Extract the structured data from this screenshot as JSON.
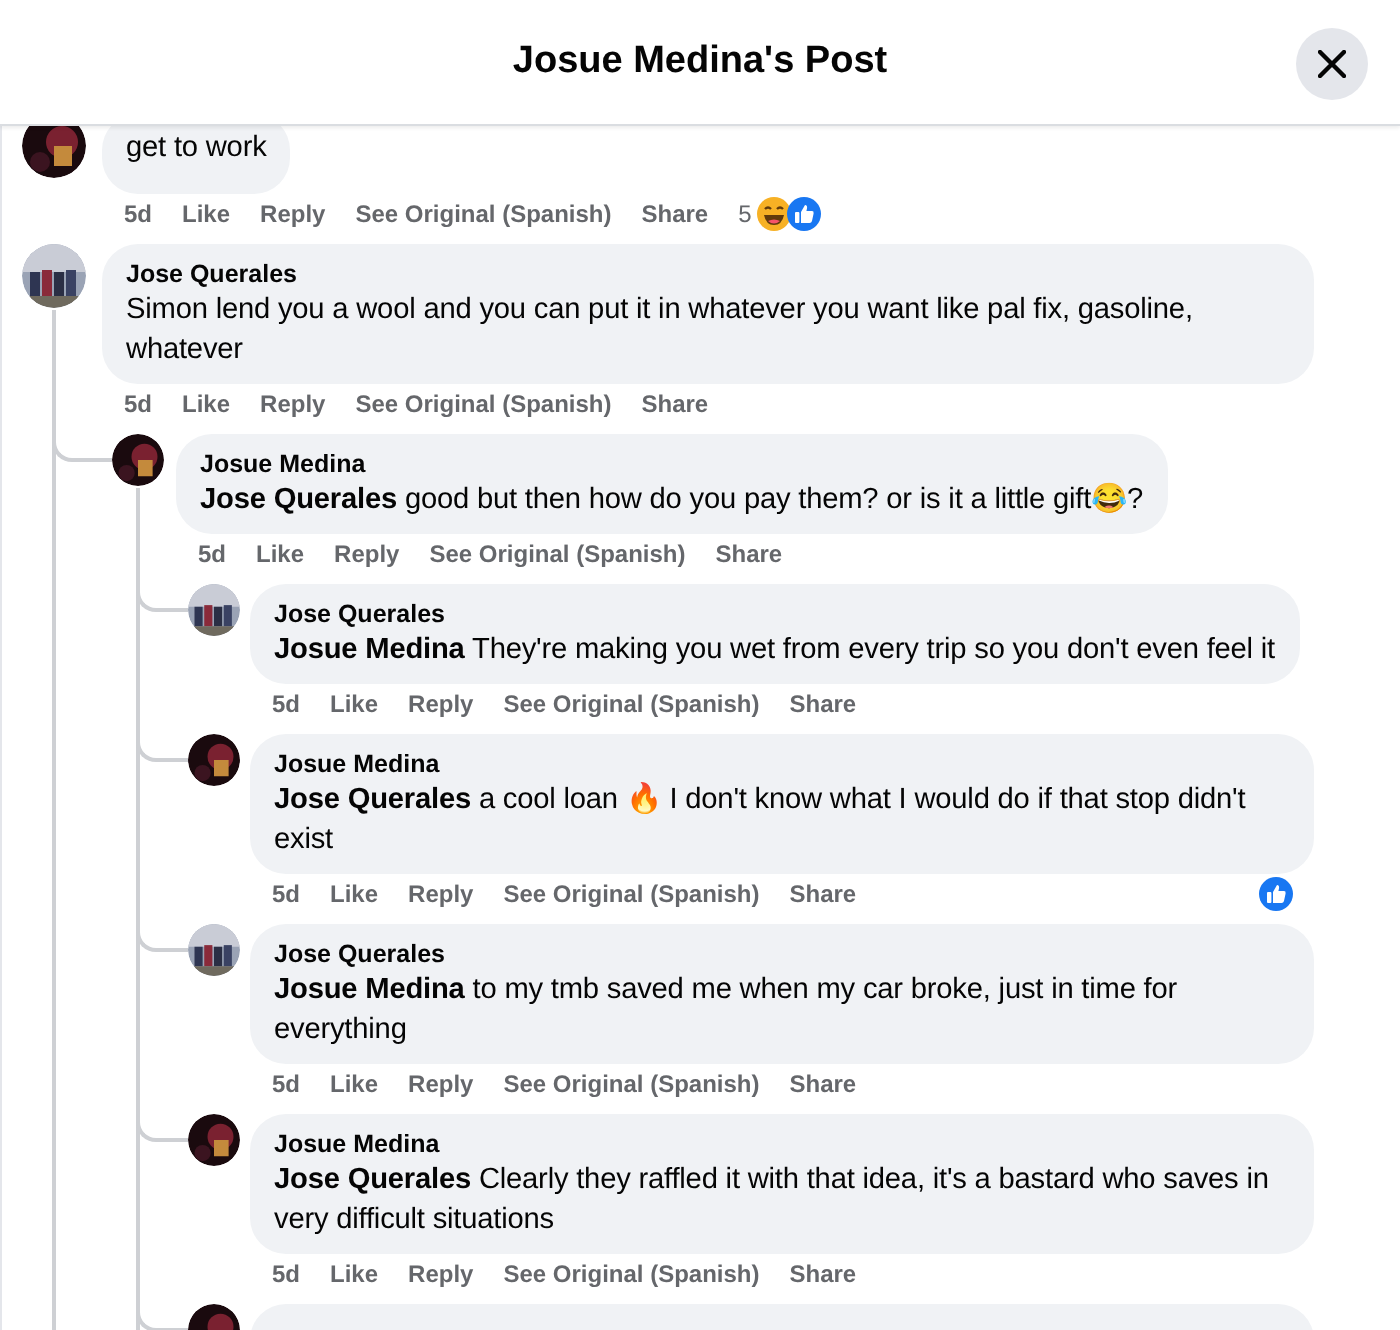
{
  "title": "Josue Medina's Post",
  "comments": [
    {
      "kind": "dark",
      "text": "get to work",
      "time": "5d",
      "actions": [
        "Like",
        "Reply",
        "See Original (Spanish)",
        "Share"
      ],
      "reaction_count": "5",
      "reactions": [
        {
          "kind": "haha"
        },
        {
          "kind": "like"
        }
      ]
    },
    {
      "kind": "group",
      "name": "Jose Querales",
      "text": "Simon lend you a wool and you can put it in whatever you want like pal fix, gasoline, whatever",
      "time": "5d",
      "actions": [
        "Like",
        "Reply",
        "See Original (Spanish)",
        "Share"
      ],
      "children": [
        {
          "kind": "dark",
          "name": "Josue Medina",
          "text": "**Jose Querales** good but then how do you pay them? or is it a little gift😂?",
          "time": "5d",
          "actions": [
            "Like",
            "Reply",
            "See Original (Spanish)",
            "Share"
          ],
          "children": [
            {
              "kind": "group",
              "name": "Jose Querales",
              "text": "**Josue Medina** They're making you wet from every trip so you don't even feel it",
              "time": "5d",
              "actions": [
                "Like",
                "Reply",
                "See Original (Spanish)",
                "Share"
              ]
            },
            {
              "kind": "dark",
              "name": "Josue Medina",
              "text": "**Jose Querales** a cool loan 🔥 I don't know what I would do if that stop didn't exist",
              "time": "5d",
              "actions": [
                "Like",
                "Reply",
                "See Original (Spanish)",
                "Share"
              ],
              "reactions": [
                {
                  "kind": "like"
                }
              ]
            },
            {
              "kind": "group",
              "name": "Jose Querales",
              "text": "**Josue Medina** to my tmb saved me when my car broke, just in time for everything",
              "time": "5d",
              "actions": [
                "Like",
                "Reply",
                "See Original (Spanish)",
                "Share"
              ]
            },
            {
              "kind": "dark",
              "name": "Josue Medina",
              "text": "**Jose Querales** Clearly they raffled it with that idea, it's a bastard who saves in very difficult situations",
              "time": "5d",
              "actions": [
                "Like",
                "Reply",
                "See Original (Spanish)",
                "Share"
              ]
            },
            {
              "kind": "dark"
            }
          ]
        }
      ]
    }
  ]
}
